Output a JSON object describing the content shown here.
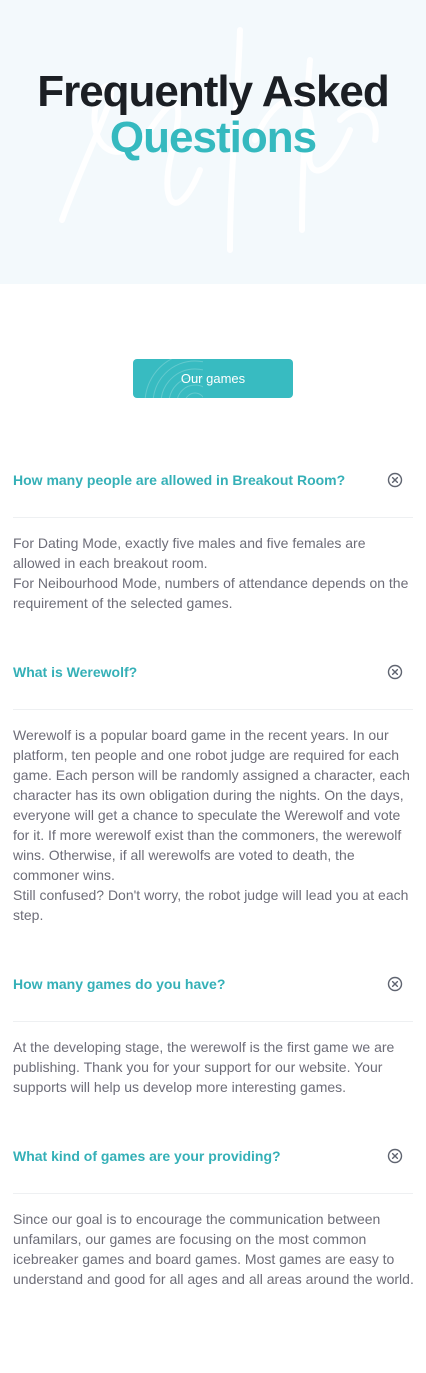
{
  "hero": {
    "title": "Frequently Asked",
    "subtitle": "Questions"
  },
  "cta": {
    "label": "Our games"
  },
  "faq": [
    {
      "question": "How many people are allowed in Breakout Room?",
      "answer": [
        "For Dating Mode, exactly five males and five females are allowed in each breakout room.",
        "For Neibourhood Mode, numbers of attendance depends on the requirement of the selected games."
      ]
    },
    {
      "question": "What is Werewolf?",
      "answer": [
        "Werewolf is a popular board game in the recent years. In our platform, ten people and one robot judge are required for each game. Each person will be randomly assigned a character, each character has its own obligation during the nights. On the days, everyone will get a chance to speculate the Werewolf and vote for it. If more werewolf exist than the commoners, the werewolf wins. Otherwise, if all werewolfs are voted to death, the commoner wins.",
        "Still confused? Don't worry, the robot judge will lead you at each step."
      ]
    },
    {
      "question": "How many games do you have?",
      "answer": [
        "At the developing stage, the werewolf is the first game we are publishing. Thank you for your support for our website. Your supports will help us develop more interesting games."
      ]
    },
    {
      "question": "What kind of games are your providing?",
      "answer": [
        "Since our goal is to encourage the communication between unfamilars, our games are focusing on the most common icebreaker games and board games. Most games are easy to understand and good for all ages and all areas around the world."
      ]
    }
  ],
  "icons": {
    "toggle": "close-circle-icon"
  },
  "colors": {
    "accent": "#35b9bf",
    "heading": "#1b1f24",
    "hero_bg": "#f3f9fc",
    "answer_text": "#6d6d78"
  }
}
